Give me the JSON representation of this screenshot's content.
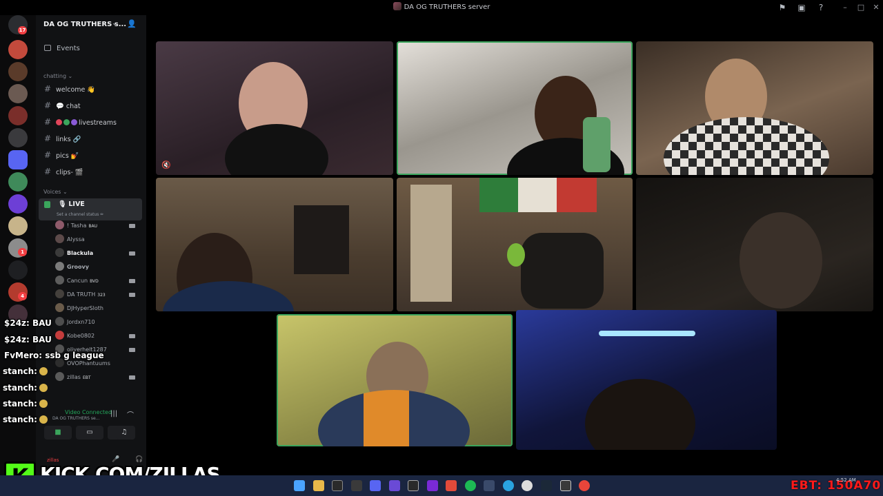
{
  "window": {
    "title": "DA OG TRUTHERS server",
    "controls": [
      "minimize",
      "maximize",
      "close"
    ]
  },
  "rail": {
    "home_badge": "17",
    "dm_badges": [
      "4",
      "1"
    ]
  },
  "sidebar": {
    "server_name": "DA OG TRUTHERS s...",
    "events_label": "Events",
    "categories": {
      "chatting": "chatting",
      "voices": "Voices"
    },
    "channels": [
      {
        "label": "welcome 👋"
      },
      {
        "label": "💬 chat"
      },
      {
        "label": "livestreams"
      },
      {
        "label": "links 🔗"
      },
      {
        "label": "pics 💅"
      },
      {
        "label": "clips- 🎬"
      }
    ],
    "live_channel": {
      "label": "🎙 LIVE",
      "status_placeholder": "Set a channel status ✏"
    },
    "voice_users": [
      {
        "name": "! Tasha",
        "tag": "BAU"
      },
      {
        "name": "Alyssa",
        "tag": ""
      },
      {
        "name": "Blackula",
        "tag": ""
      },
      {
        "name": "Groovy",
        "tag": ""
      },
      {
        "name": "Cancun",
        "tag": "BVD"
      },
      {
        "name": "DA TRUTH",
        "tag": "323"
      },
      {
        "name": "DJHyperSloth",
        "tag": ""
      },
      {
        "name": "Jordxn710",
        "tag": ""
      },
      {
        "name": "Kobe0802",
        "tag": ""
      },
      {
        "name": "oliverhelt1287",
        "tag": ""
      },
      {
        "name": "OVOPhantuums",
        "tag": ""
      },
      {
        "name": "zillas",
        "tag": "EBT"
      }
    ],
    "voice_bar": {
      "status": "Video Connected",
      "server": "DA OG TRUTHERS se..."
    },
    "user_panel_name": "zillas"
  },
  "chat_overlay": [
    {
      "user": "$24z:",
      "text": "BAU"
    },
    {
      "user": "$24z:",
      "text": "BAU"
    },
    {
      "user": "FvMero:",
      "text": "ssb g league"
    },
    {
      "user": "stanch:",
      "text": ""
    },
    {
      "user": "stanch:",
      "text": ""
    },
    {
      "user": "stanch:",
      "text": ""
    },
    {
      "user": "stanch:",
      "text": ""
    }
  ],
  "video_tiles": [
    {
      "id": "tile-1",
      "speaking": false,
      "muted": true,
      "bg": "#3a2d33"
    },
    {
      "id": "tile-2",
      "speaking": true,
      "muted": false,
      "bg": "#b9b5ae"
    },
    {
      "id": "tile-3",
      "speaking": false,
      "muted": false,
      "bg": "#6e5947"
    },
    {
      "id": "tile-4",
      "speaking": false,
      "muted": false,
      "bg": "#5a4a39"
    },
    {
      "id": "tile-5",
      "speaking": false,
      "muted": false,
      "bg": "#4e4236"
    },
    {
      "id": "tile-6",
      "speaking": false,
      "muted": false,
      "bg": "#1b1917"
    },
    {
      "id": "tile-7",
      "speaking": false,
      "muted": false,
      "bg": "#a8a55c"
    },
    {
      "id": "tile-8",
      "speaking": false,
      "muted": false,
      "bg": "#1a1f4a"
    }
  ],
  "overlay": {
    "kick_url": "KICK.COM/ZILLAS",
    "ebt_ticker": "EBT: 150A70"
  },
  "taskbar": {
    "clock": "4:52 AM"
  },
  "colors": {
    "speaking": "#3ba55c",
    "kick_green": "#53fc18",
    "ebt_red": "#ff1a1a",
    "badge": "#f23f43"
  }
}
